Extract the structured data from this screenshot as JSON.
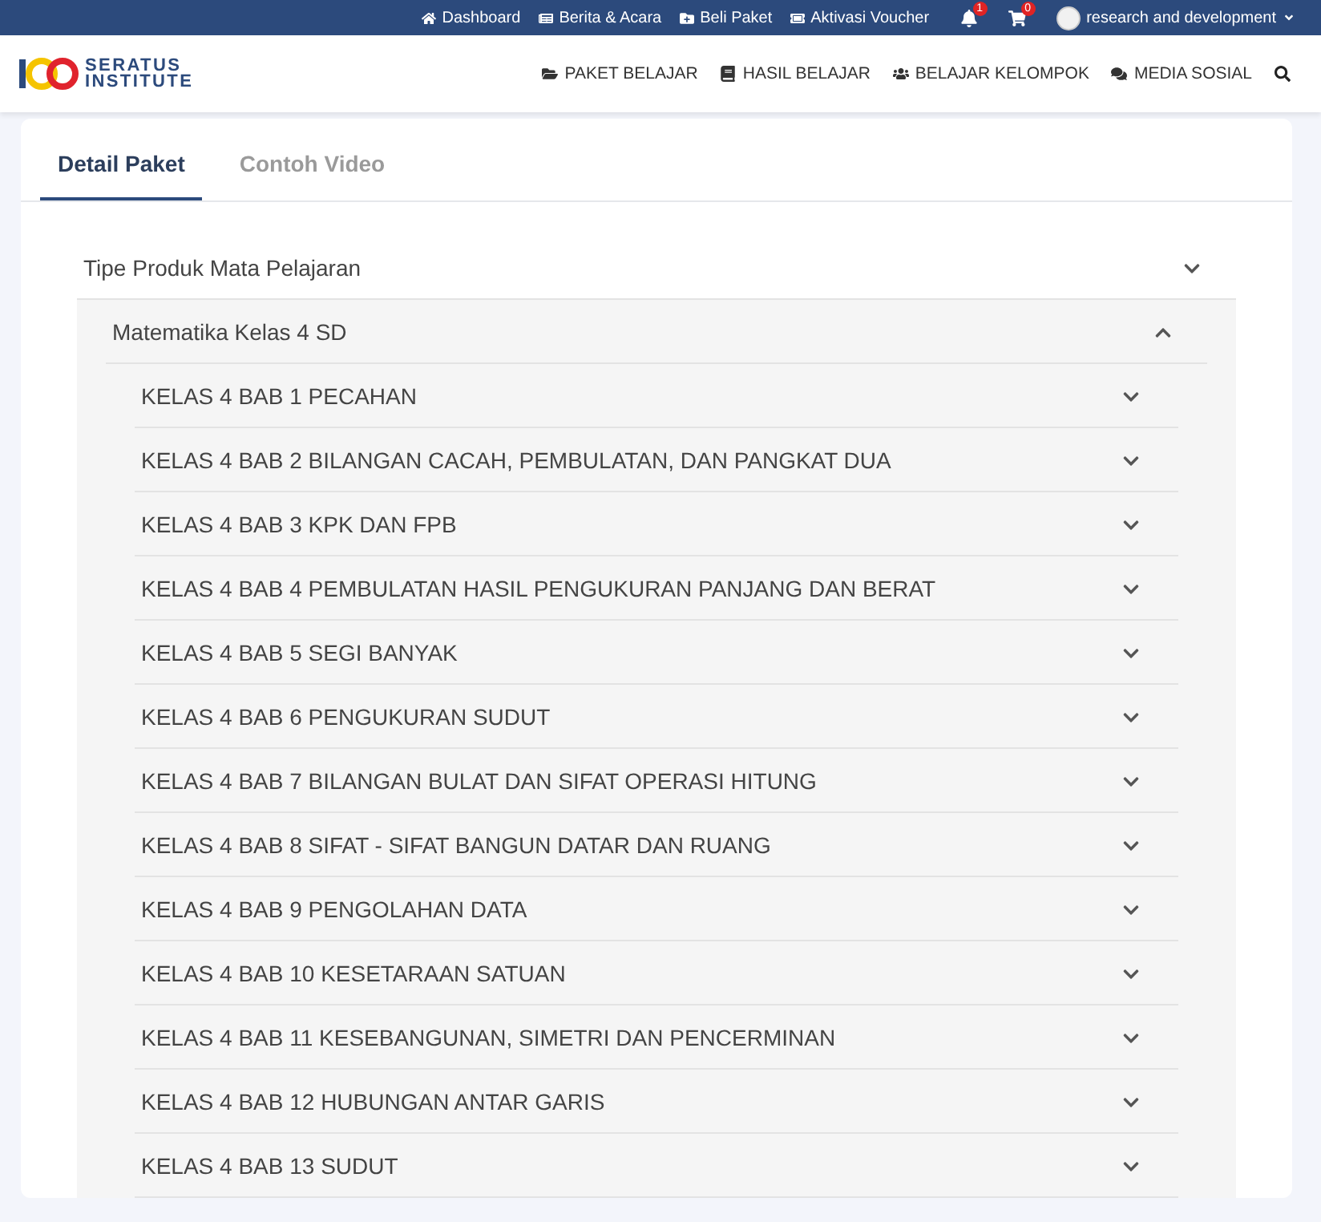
{
  "top_bar": {
    "links": [
      {
        "kind": "home",
        "label": "Dashboard"
      },
      {
        "kind": "news",
        "label": "Berita & Acara"
      },
      {
        "kind": "buy",
        "label": "Beli Paket"
      },
      {
        "kind": "voucher",
        "label": "Aktivasi Voucher"
      }
    ],
    "notification_count": "1",
    "cart_count": "0",
    "user": "research and development"
  },
  "nav": {
    "logo": [
      "SERATUS",
      "INSTITUTE"
    ],
    "items": [
      {
        "kind": "folder",
        "label": "PAKET BELAJAR"
      },
      {
        "kind": "book",
        "label": "HASIL BELAJAR"
      },
      {
        "kind": "group",
        "label": "BELAJAR KELOMPOK"
      },
      {
        "kind": "chat",
        "label": "MEDIA SOSIAL"
      }
    ]
  },
  "tabs": [
    {
      "label": "Detail Paket",
      "selected": true
    },
    {
      "label": "Contoh Video",
      "selected": false
    }
  ],
  "product_type": {
    "title": "Tipe Produk Mata Pelajaran",
    "subject": {
      "title": "Matematika Kelas 4 SD",
      "expanded": true,
      "chapters": [
        {
          "title": "KELAS 4 BAB 1 PECAHAN",
          "expanded": false
        },
        {
          "title": "KELAS 4 BAB 2 BILANGAN CACAH, PEMBULATAN, DAN PANGKAT DUA",
          "expanded": false
        },
        {
          "title": "KELAS 4 BAB 3 KPK DAN FPB",
          "expanded": false
        },
        {
          "title": "KELAS 4 BAB 4 PEMBULATAN HASIL PENGUKURAN PANJANG DAN BERAT",
          "expanded": false
        },
        {
          "title": "KELAS 4 BAB 5 SEGI BANYAK",
          "expanded": false
        },
        {
          "title": "KELAS 4 BAB 6 PENGUKURAN SUDUT",
          "expanded": false
        },
        {
          "title": "KELAS 4 BAB 7 BILANGAN BULAT DAN SIFAT OPERASI HITUNG",
          "expanded": false
        },
        {
          "title": "KELAS 4 BAB 8 SIFAT - SIFAT BANGUN DATAR DAN RUANG",
          "expanded": false
        },
        {
          "title": "KELAS 4 BAB 9 PENGOLAHAN DATA",
          "expanded": false
        },
        {
          "title": "KELAS 4 BAB 10 KESETARAAN SATUAN",
          "expanded": false
        },
        {
          "title": "KELAS 4 BAB 11 KESEBANGUNAN, SIMETRI DAN PENCERMINAN",
          "expanded": false
        },
        {
          "title": "KELAS 4 BAB 12 HUBUNGAN ANTAR GARIS",
          "expanded": false
        },
        {
          "title": "KELAS 4 BAB 13 SUDUT",
          "expanded": false
        }
      ]
    }
  }
}
